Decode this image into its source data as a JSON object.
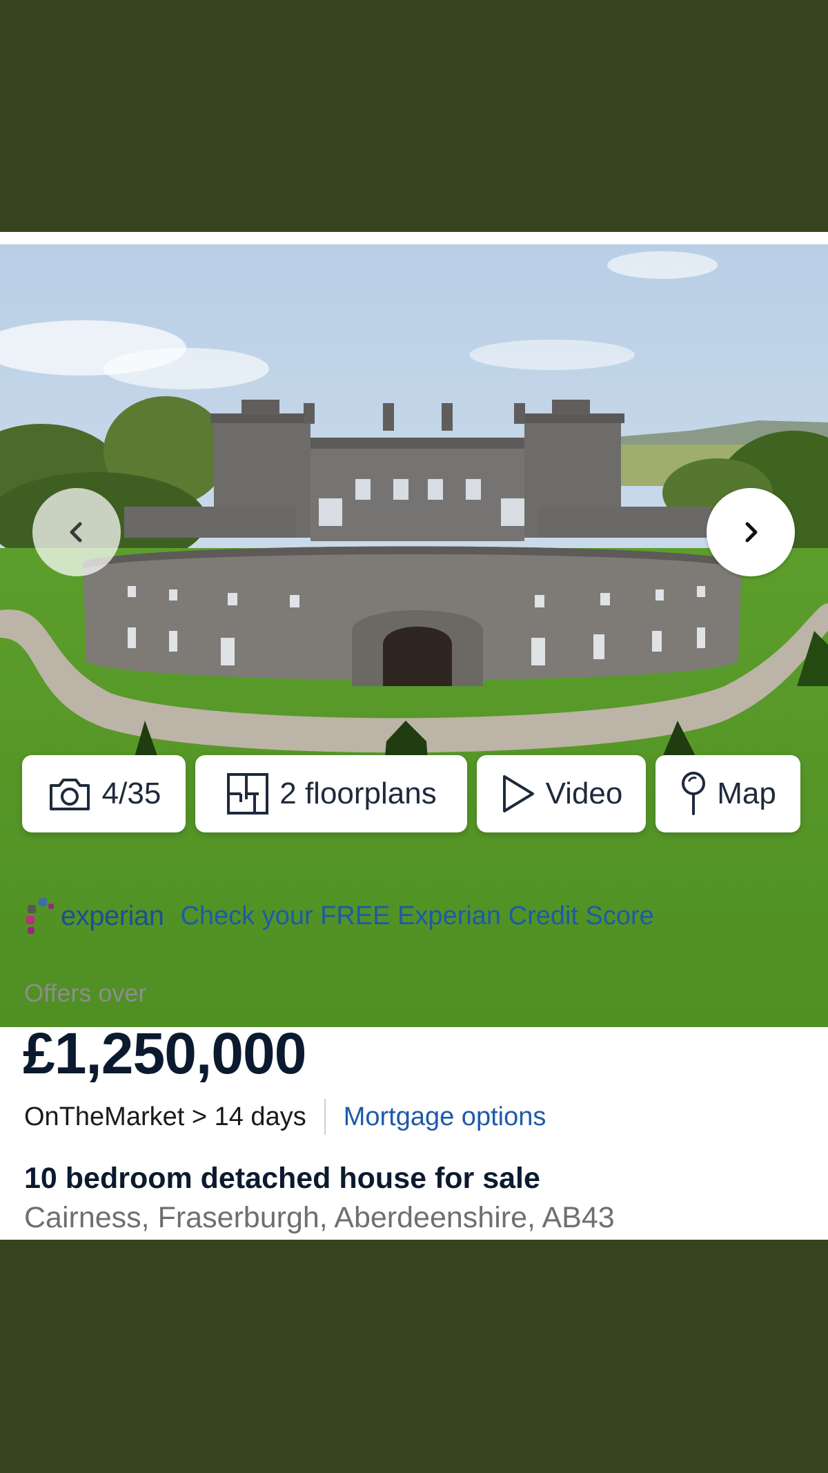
{
  "photo": {
    "alt": "Cairness House",
    "prev_icon": "chevron-left-icon",
    "next_icon": "chevron-right-icon"
  },
  "media_bar": {
    "photos": {
      "icon": "camera-icon",
      "label": "4/35"
    },
    "floorplans": {
      "icon": "floorplan-icon",
      "label": "2 floorplans"
    },
    "video": {
      "icon": "play-icon",
      "label": "Video"
    },
    "map": {
      "icon": "map-pin-icon",
      "label": "Map"
    }
  },
  "experian": {
    "logo_text": "experian",
    "link_text": "Check your FREE Experian Credit Score"
  },
  "listing": {
    "price_qualifier": "Offers over",
    "price": "£1,250,000",
    "market_info": "OnTheMarket > 14 days",
    "mortgage_link": "Mortgage options",
    "title": "10 bedroom detached house for sale",
    "address": "Cairness, Fraserburgh, Aberdeenshire, AB43"
  },
  "colors": {
    "background": "#37421f",
    "card": "#ffffff",
    "price_text": "#0b1a2e",
    "link_blue": "#1d5aa8",
    "experian_blue": "#1d4f91"
  }
}
